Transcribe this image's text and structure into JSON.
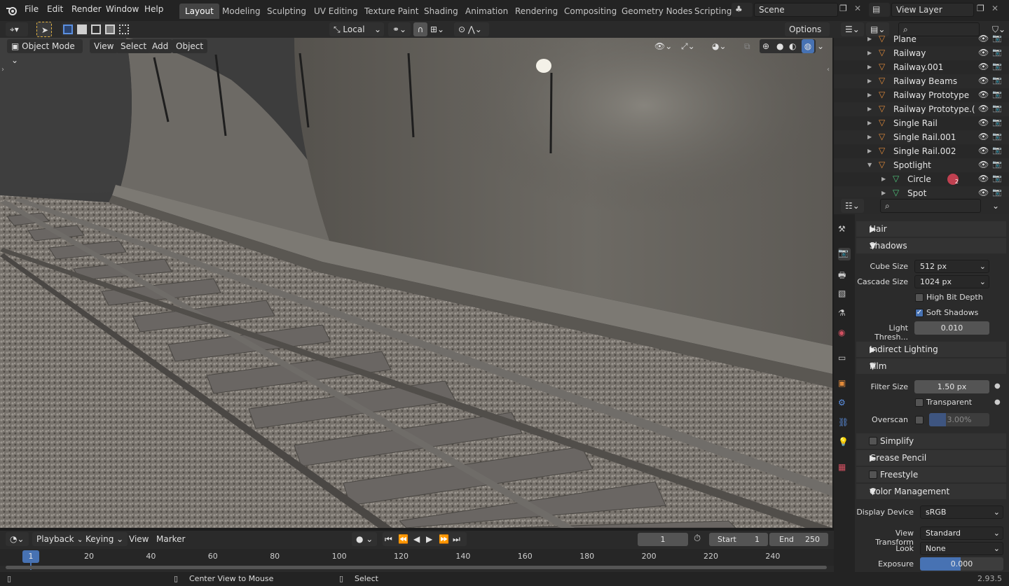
{
  "menu": {
    "file": "File",
    "edit": "Edit",
    "render": "Render",
    "window": "Window",
    "help": "Help"
  },
  "workspaces": [
    "Layout",
    "Modeling",
    "Sculpting",
    "UV Editing",
    "Texture Paint",
    "Shading",
    "Animation",
    "Rendering",
    "Compositing",
    "Geometry Nodes",
    "Scripting"
  ],
  "scene": {
    "name": "Scene"
  },
  "view_layer": {
    "name": "View Layer"
  },
  "viewport_header": {
    "transform_orientation": "Local",
    "options": "Options",
    "mode": "Object Mode",
    "view": "View",
    "select": "Select",
    "add": "Add",
    "object": "Object"
  },
  "outliner": {
    "items": [
      {
        "label": "Plane"
      },
      {
        "label": "Railway"
      },
      {
        "label": "Railway.001"
      },
      {
        "label": "Railway Beams"
      },
      {
        "label": "Railway Prototype"
      },
      {
        "label": "Railway Prototype.("
      },
      {
        "label": "Single Rail"
      },
      {
        "label": "Single Rail.001"
      },
      {
        "label": "Single Rail.002"
      },
      {
        "label": "Spotlight"
      },
      {
        "label": "Circle"
      },
      {
        "label": "Spot"
      }
    ],
    "circle_badge": "2"
  },
  "properties": {
    "hair": "Hair",
    "shadows": "Shadows",
    "cube_size_label": "Cube Size",
    "cube_size": "512 px",
    "cascade_size_label": "Cascade Size",
    "cascade_size": "1024 px",
    "high_bit_depth": "High Bit Depth",
    "soft_shadows": "Soft Shadows",
    "light_threshold_label": "Light Thresh...",
    "light_threshold": "0.010",
    "indirect_lighting": "Indirect Lighting",
    "film": "Film",
    "filter_size_label": "Filter Size",
    "filter_size": "1.50 px",
    "transparent": "Transparent",
    "overscan_label": "Overscan",
    "overscan": "3.00%",
    "simplify": "Simplify",
    "grease_pencil": "Grease Pencil",
    "freestyle": "Freestyle",
    "color_management": "Color Management",
    "display_device_label": "Display Device",
    "display_device": "sRGB",
    "view_transform_label": "View Transform",
    "view_transform": "Standard",
    "look_label": "Look",
    "look": "None",
    "exposure_label": "Exposure",
    "exposure": "0.000"
  },
  "timeline": {
    "playback": "Playback",
    "keying": "Keying",
    "view": "View",
    "marker": "Marker",
    "current_frame": "1",
    "start_label": "Start",
    "start": "1",
    "end_label": "End",
    "end": "250",
    "ticks": [
      "20",
      "40",
      "60",
      "80",
      "100",
      "120",
      "140",
      "160",
      "180",
      "200",
      "220",
      "240"
    ],
    "playhead": "1"
  },
  "status": {
    "center_view": "Center View to Mouse",
    "select": "Select",
    "version": "2.93.5"
  },
  "colors": {
    "accent": "#4772b3",
    "header": "#232323"
  }
}
